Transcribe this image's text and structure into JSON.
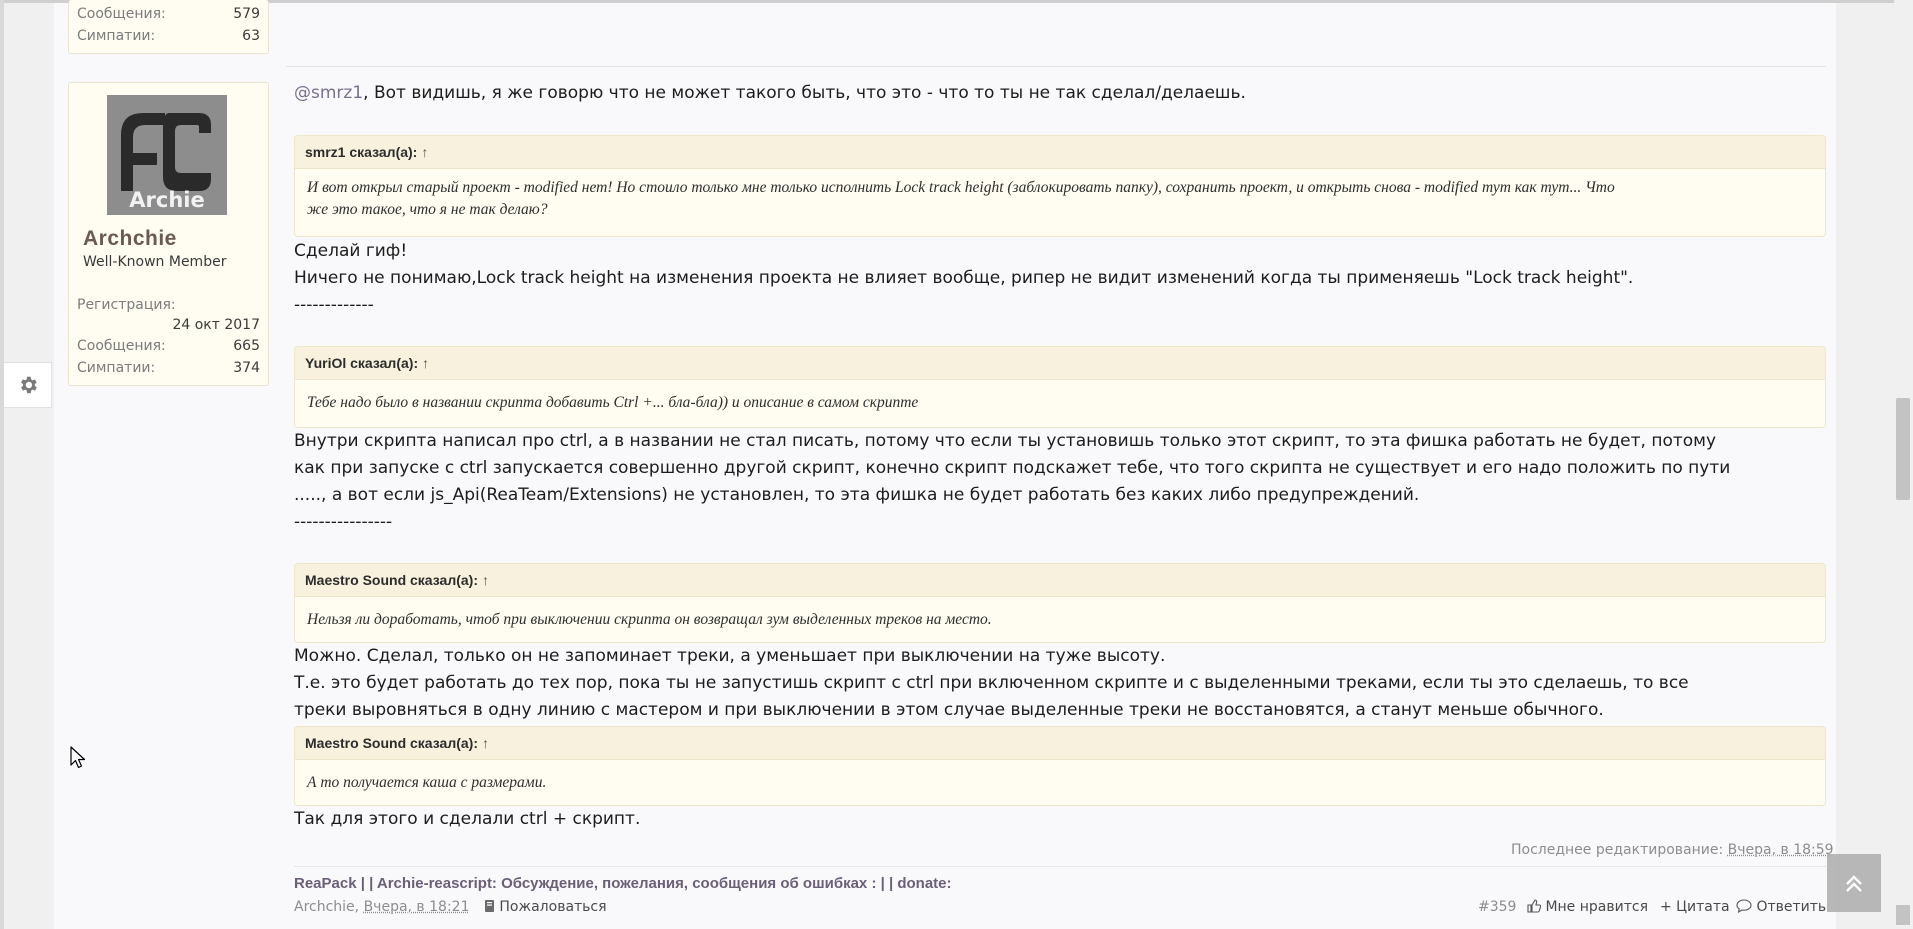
{
  "prev_author_stats": {
    "messages_label": "Сообщения:",
    "messages_value": "579",
    "likes_label": "Симпатии:",
    "likes_value": "63"
  },
  "post": {
    "author": {
      "avatar_text": "Archie",
      "name": "Archchie",
      "rank": "Well-Known Member",
      "registered_label": "Регистрация:",
      "registered_value": "24 окт 2017",
      "messages_label": "Сообщения:",
      "messages_value": "665",
      "likes_label": "Симпатии:",
      "likes_value": "374"
    },
    "intro_mention": "@smrz1",
    "intro_text": ", Вот видишь, я же говорю что не может такого быть, что это - что то ты не так сделал/делаешь.",
    "quote1": {
      "header": "smrz1 сказал(а):",
      "line1": "И вот открыл старый проект - modified нет! Но стоило только мне только исполнить Lock track height (заблокировать папку), сохранить проект, и открыть снова - modified тут как тут... Что",
      "line2": "же это такое, что я не так делаю?"
    },
    "para1_line1": "Сделай гиф!",
    "para1_line2": "Ничего не понимаю,Lock track height на изменения проекта не влияет вообще, рипер не видит изменений когда ты применяешь \"Lock track height\".",
    "para1_line3": "-------------",
    "quote2": {
      "header": "YuriOl сказал(а):",
      "line1": "Тебе надо было в названии скрипта добавить Ctrl +... бла-бла)) и описание в самом скрипте"
    },
    "para2_line1": "Внутри скрипта написал про ctrl, а в названии не стал писать, потому что если ты установишь только этот скрипт, то эта фишка работать не будет, потому",
    "para2_line2": "как при запуске с ctrl запускается совершенно другой скрипт, конечно скрипт подскажет тебе, что того скрипта не существует и его надо положить по пути",
    "para2_line3": "....., а вот если js_Api(ReaTeam/Extensions) не установлен, то эта фишка не будет работать без каких либо предупреждений.",
    "para2_line4": "----------------",
    "quote3": {
      "header": "Maestro Sound сказал(а):",
      "line1": "Нельзя ли доработать, чтоб при выключении скрипта он возвращал зум выделенных треков на место."
    },
    "para3_line1": "Можно. Сделал, только он не запоминает треки, а уменьшает при выключении на туже высоту.",
    "para3_line2": "Т.е. это будет работать до тех пор, пока ты не запустишь скрипт с ctrl при включенном скрипте и с выделенными треками, если ты это сделаешь, то все",
    "para3_line3": "треки выровняться в одну линию с мастером и при выключении в этом случае выделенные треки не восстановятся, а станут меньше обычного.",
    "quote4": {
      "header": "Maestro Sound сказал(а):",
      "line1": "А то получается каша с размерами."
    },
    "para4_line1": "Так для этого и сделали ctrl + скрипт.",
    "quote_arrow": "↑",
    "edit_label": "Последнее редактирование: ",
    "edit_date": "Вчера, в 18:59",
    "signature": "ReaPack | | Archie-reascript: Обсуждение, пожелания, сообщения об ошибках : | | donate:",
    "meta_author": "Archchie",
    "meta_sep": ", ",
    "meta_date": "Вчера, в 18:21",
    "report_label": "Пожаловаться",
    "post_number": "#359",
    "like_label": "Мне нравится",
    "quote_label": "+ Цитата",
    "reply_label": "Ответить"
  },
  "icons": [
    "gear-icon",
    "thumbs-up-icon",
    "comment-icon",
    "report-icon",
    "scroll-top-icon",
    "mouse-cursor-icon"
  ],
  "colors": {
    "quote_bg": "#fffdf1",
    "quote_header_bg": "#f7f1dd",
    "username": "#6a5a52",
    "mention": "#7b6f8f"
  }
}
